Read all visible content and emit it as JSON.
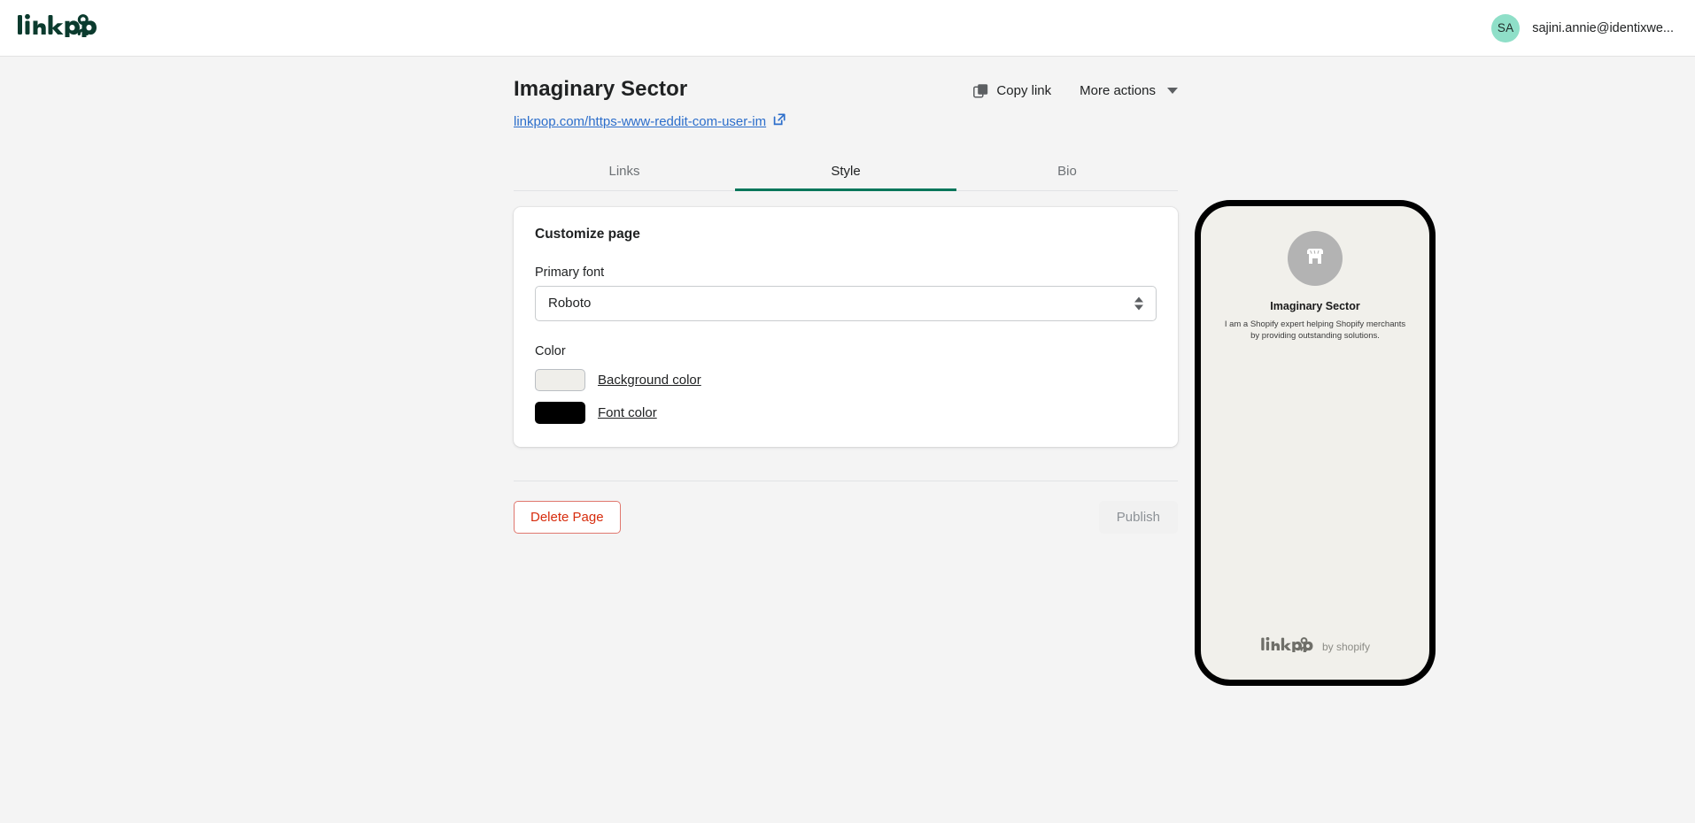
{
  "topbar": {
    "logo_text": "linkpop",
    "logo_icon": "linkpop-person-icon",
    "avatar_initials": "SA",
    "email": "sajini.annie@identixwe..."
  },
  "header": {
    "title": "Imaginary Sector",
    "url": "linkpop.com/https-www-reddit-com-user-im",
    "external_link_icon": "external-link-icon",
    "copy_link_label": "Copy link",
    "copy_icon": "copy-icon",
    "more_actions_label": "More actions",
    "caret_icon": "chevron-down-icon"
  },
  "tabs": [
    {
      "label": "Links",
      "active": false
    },
    {
      "label": "Style",
      "active": true
    },
    {
      "label": "Bio",
      "active": false
    }
  ],
  "card": {
    "title": "Customize page",
    "primary_font_label": "Primary font",
    "primary_font_value": "Roboto",
    "primary_font_options": [
      "Roboto"
    ],
    "color_label": "Color",
    "background_color_label": "Background color",
    "background_color_value": "#efeeea",
    "font_color_label": "Font color",
    "font_color_value": "#000000"
  },
  "footer": {
    "delete_label": "Delete Page",
    "publish_label": "Publish"
  },
  "preview": {
    "avatar_icon": "store-icon",
    "name": "Imaginary Sector",
    "bio": "I am a Shopify expert helping Shopify merchants by providing outstanding solutions.",
    "footer_logo_text": "linkpop",
    "footer_byline": "by shopify",
    "background_color": "#f1f0eb"
  },
  "colors": {
    "accent_green": "#00765a",
    "link_blue": "#2c6ecb",
    "danger_red": "#d72c0d",
    "avatar_mint": "#8fdfc8",
    "page_bg": "#f4f4f4"
  }
}
